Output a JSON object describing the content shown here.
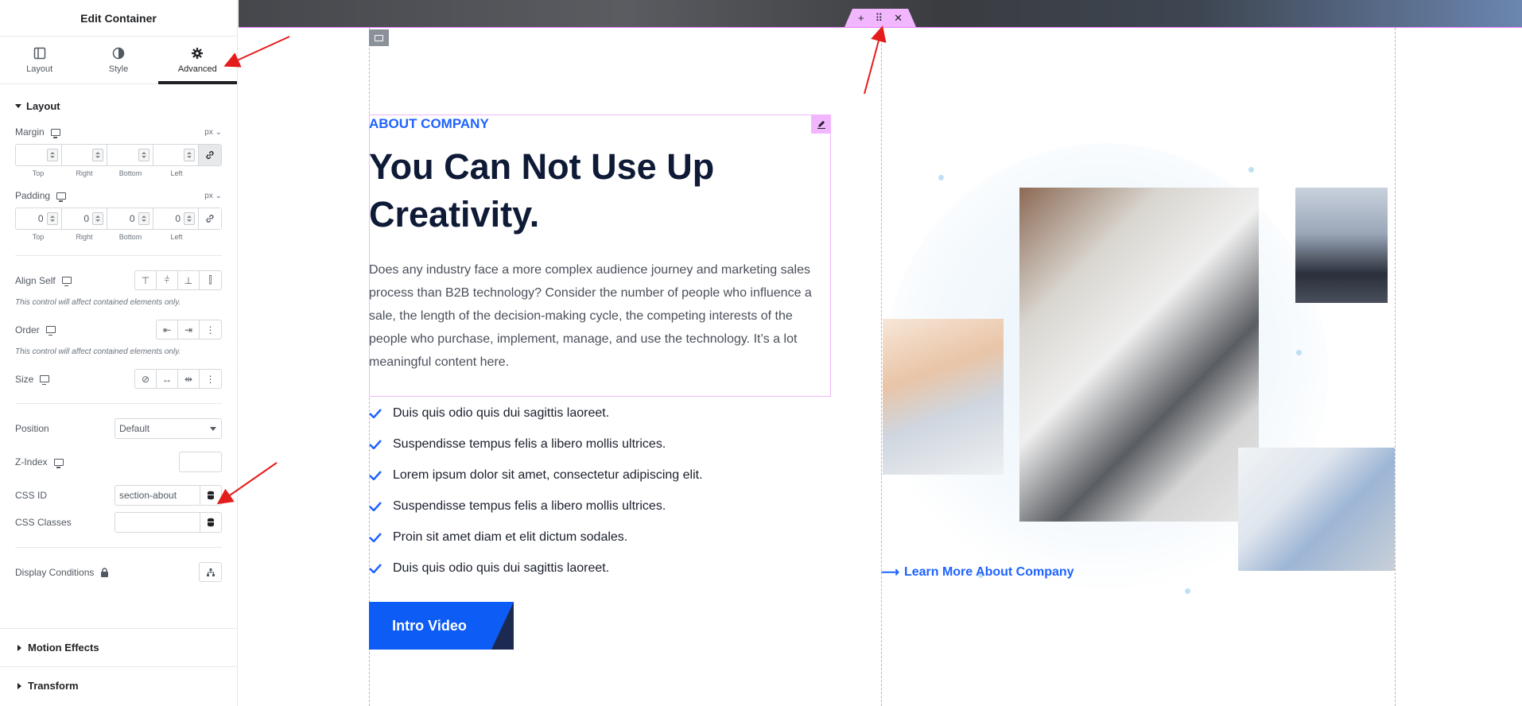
{
  "panel": {
    "title": "Edit Container",
    "tabs": [
      {
        "label": "Layout",
        "icon": "layout-icon"
      },
      {
        "label": "Style",
        "icon": "contrast-icon"
      },
      {
        "label": "Advanced",
        "icon": "gear-icon",
        "active": true
      }
    ],
    "layout_section": {
      "title": "Layout",
      "margin": {
        "label": "Margin",
        "unit": "px",
        "values": [
          "",
          "",
          "",
          ""
        ],
        "sublabels": [
          "Top",
          "Right",
          "Bottom",
          "Left"
        ],
        "linked": true
      },
      "padding": {
        "label": "Padding",
        "unit": "px",
        "values": [
          "0",
          "0",
          "0",
          "0"
        ],
        "sublabels": [
          "Top",
          "Right",
          "Bottom",
          "Left"
        ],
        "linked": false
      },
      "align_self": {
        "label": "Align Self",
        "hint": "This control will affect contained elements only."
      },
      "order": {
        "label": "Order",
        "hint": "This control will affect contained elements only."
      },
      "size": {
        "label": "Size"
      },
      "position": {
        "label": "Position",
        "value": "Default"
      },
      "z_index": {
        "label": "Z-Index",
        "value": ""
      },
      "css_id": {
        "label": "CSS ID",
        "value": "section-about"
      },
      "css_classes": {
        "label": "CSS Classes",
        "value": ""
      },
      "display_conditions": {
        "label": "Display Conditions"
      }
    },
    "collapsed_sections": [
      "Motion Effects",
      "Transform"
    ]
  },
  "canvas": {
    "about_label": "ABOUT COMPANY",
    "title": "You Can Not Use Up Creativity.",
    "description": "Does any industry face a more complex audience journey and marketing sales process than B2B technology? Consider the number of people who influence a sale, the length of the decision-making cycle, the competing interests of the people who purchase, implement, manage, and use the technology. It’s a lot meaningful content here.",
    "checklist": [
      "Duis quis odio quis dui sagittis laoreet.",
      "Suspendisse tempus felis a libero mollis ultrices.",
      "Lorem ipsum dolor sit amet, consectetur adipiscing elit.",
      "Suspendisse tempus felis a libero mollis ultrices.",
      "Proin sit amet diam et elit dictum sodales.",
      "Duis quis odio quis dui sagittis laoreet."
    ],
    "button_label": "Intro Video",
    "learn_more": "Learn More About Company",
    "handle_icons": [
      "plus-icon",
      "drag-icon",
      "close-icon"
    ],
    "accent_color": "#1e63ff",
    "selection_color": "#e580ff"
  }
}
